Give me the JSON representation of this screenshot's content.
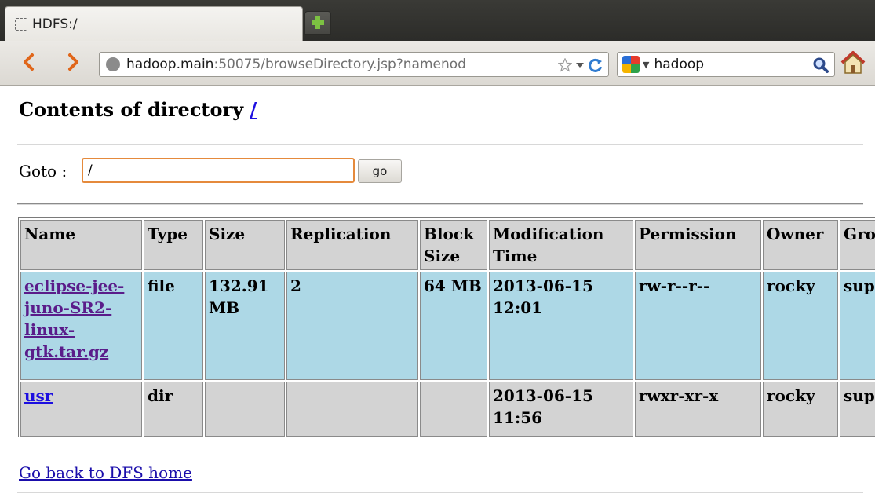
{
  "browser": {
    "tab_title": "HDFS:/",
    "url_host": "hadoop.main",
    "url_rest": ":50075/browseDirectory.jsp?namenod",
    "search_query": "hadoop"
  },
  "page": {
    "heading": "Contents of directory ",
    "root_link": "/",
    "goto_label": "Goto : ",
    "goto_value": "/",
    "go_button": "go",
    "back_link": "Go back to DFS home"
  },
  "table": {
    "headers": [
      "Name",
      "Type",
      "Size",
      "Replication",
      "Block Size",
      "Modification Time",
      "Permission",
      "Owner",
      "Group"
    ],
    "rows": [
      {
        "name": "eclipse-jee-juno-SR2-linux-gtk.tar.gz",
        "type": "file",
        "size": "132.91 MB",
        "replication": "2",
        "block_size": "64 MB",
        "modified": "2013-06-15 12:01",
        "permission": "rw-r--r--",
        "owner": "rocky",
        "group": "supergroup"
      },
      {
        "name": "usr",
        "type": "dir",
        "size": "",
        "replication": "",
        "block_size": "",
        "modified": "2013-06-15 11:56",
        "permission": "rwxr-xr-x",
        "owner": "rocky",
        "group": "supergroup"
      }
    ]
  },
  "colors": {
    "file_row": "#add8e6",
    "header_row": "#d3d3d3",
    "input_focus": "#e58a3c"
  },
  "icons": [
    "page-icon",
    "new-tab-icon",
    "back-arrow-icon",
    "forward-arrow-icon",
    "globe-icon",
    "bookmark-star-icon",
    "dropdown-arrow-icon",
    "reload-icon",
    "google-logo-icon",
    "search-icon",
    "home-icon"
  ]
}
